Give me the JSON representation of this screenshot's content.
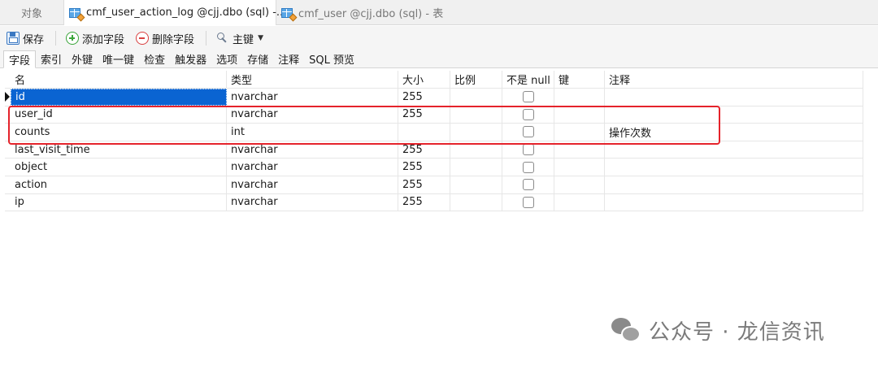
{
  "tabs": [
    {
      "label": "对象"
    },
    {
      "label": "cmf_user_action_log @cjj.dbo (sql) -..."
    },
    {
      "label": "cmf_user @cjj.dbo (sql) - 表"
    }
  ],
  "toolbar": {
    "save_label": "保存",
    "add_field_label": "添加字段",
    "delete_field_label": "删除字段",
    "primary_key_label": "主键"
  },
  "subtabs": [
    "字段",
    "索引",
    "外键",
    "唯一键",
    "检查",
    "触发器",
    "选项",
    "存储",
    "注释",
    "SQL 预览"
  ],
  "grid": {
    "headers": {
      "name": "名",
      "type": "类型",
      "size": "大小",
      "scale": "比例",
      "not_null": "不是 null",
      "key": "键",
      "comment": "注释"
    },
    "rows": [
      {
        "name": "id",
        "type": "nvarchar",
        "size": "255",
        "not_null": false,
        "comment": ""
      },
      {
        "name": "user_id",
        "type": "nvarchar",
        "size": "255",
        "not_null": false,
        "comment": ""
      },
      {
        "name": "counts",
        "type": "int",
        "size": "",
        "not_null": false,
        "comment": "操作次数"
      },
      {
        "name": "last_visit_time",
        "type": "nvarchar",
        "size": "255",
        "not_null": false,
        "comment": ""
      },
      {
        "name": "object",
        "type": "nvarchar",
        "size": "255",
        "not_null": false,
        "comment": ""
      },
      {
        "name": "action",
        "type": "nvarchar",
        "size": "255",
        "not_null": false,
        "comment": ""
      },
      {
        "name": "ip",
        "type": "nvarchar",
        "size": "255",
        "not_null": false,
        "comment": ""
      }
    ]
  },
  "watermark": {
    "text": "公众号 · 龙信资讯"
  },
  "colors": {
    "selection": "#0a64d2",
    "highlight_box": "#e5232b"
  }
}
